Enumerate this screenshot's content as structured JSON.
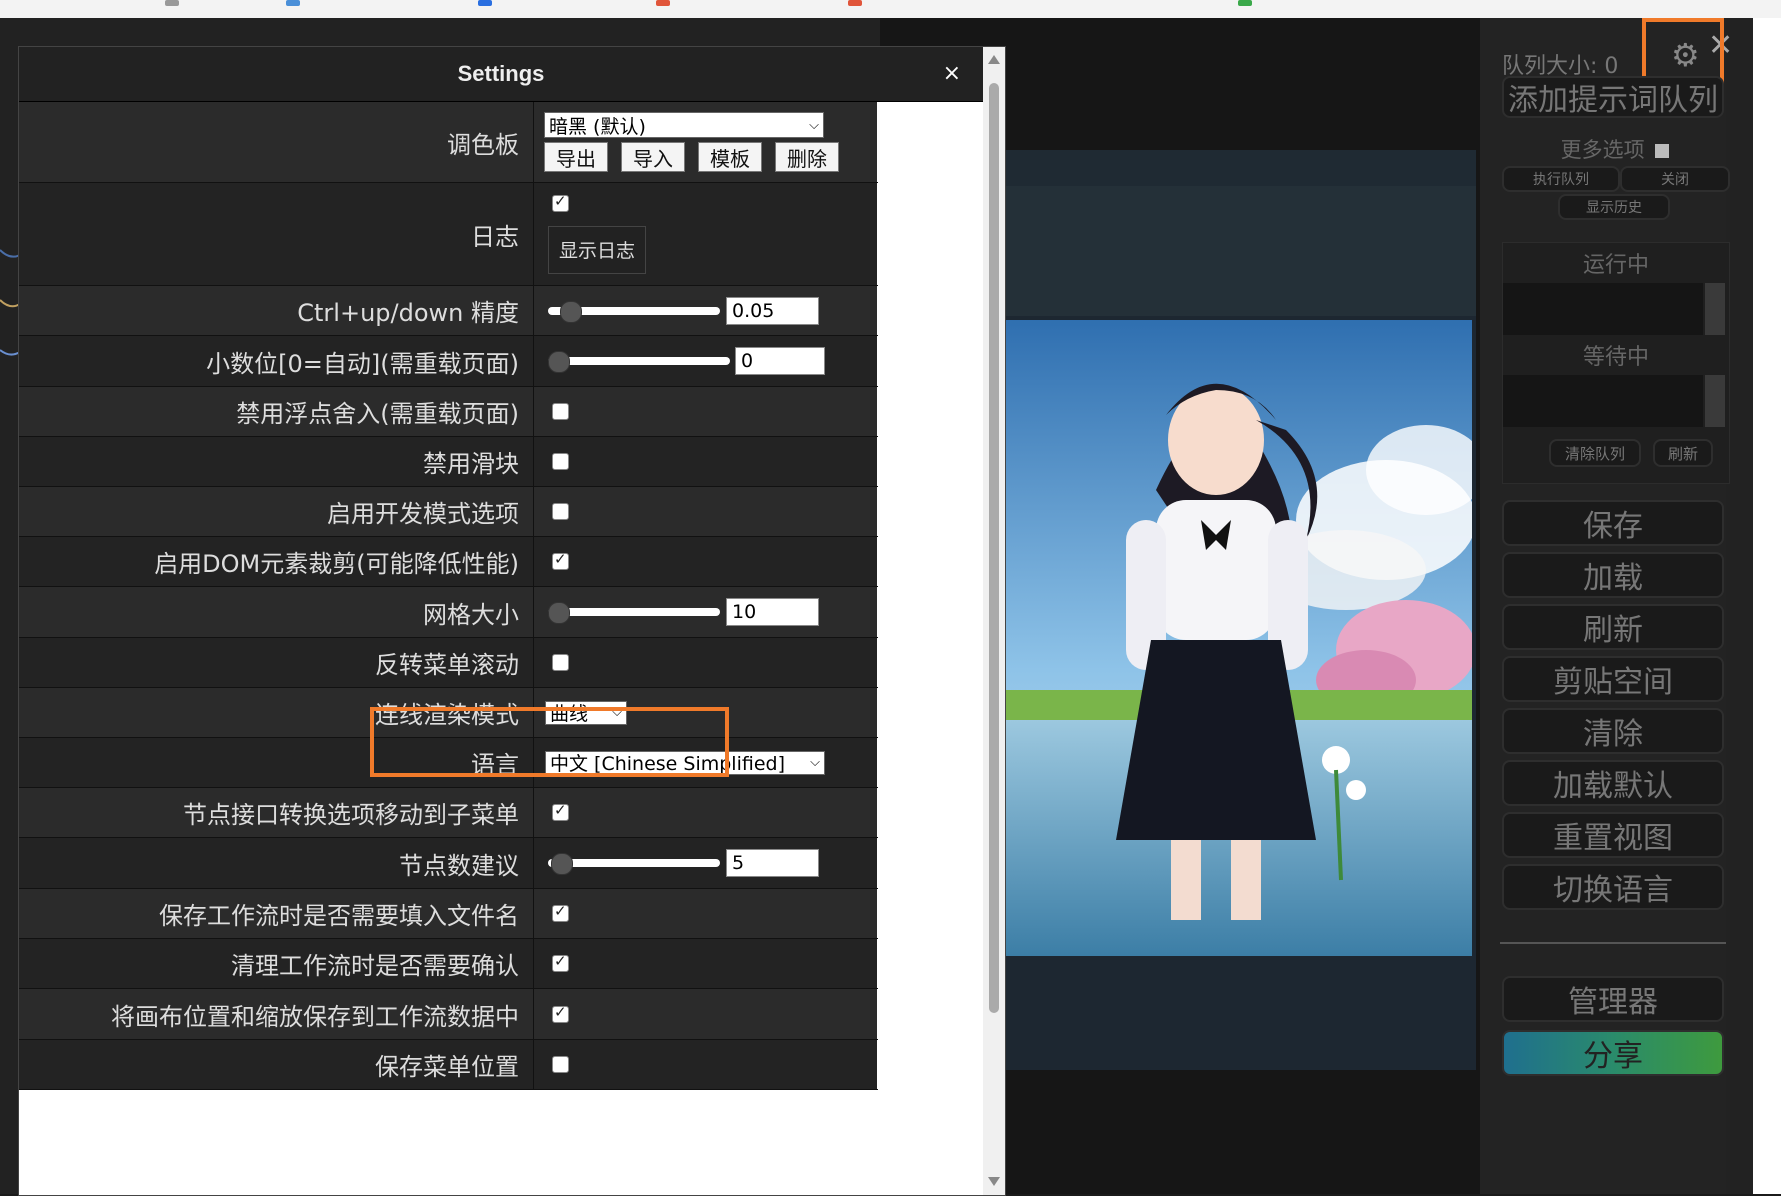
{
  "dialog": {
    "title": "Settings",
    "close": "×"
  },
  "settings": [
    {
      "label": "调色板",
      "palette": {
        "selected": "暗黑 (默认)",
        "buttons": [
          "导出",
          "导入",
          "模板",
          "删除"
        ]
      }
    },
    {
      "label": "日志",
      "checked": true,
      "button": "显示日志"
    },
    {
      "label": "Ctrl+up/down 精度",
      "slider_value": "0.05"
    },
    {
      "label": "小数位[0=自动](需重载页面)",
      "slider_value": "0"
    },
    {
      "label": "禁用浮点舍入(需重载页面)",
      "checked": false
    },
    {
      "label": "禁用滑块",
      "checked": false
    },
    {
      "label": "启用开发模式选项",
      "checked": false
    },
    {
      "label": "启用DOM元素裁剪(可能降低性能)",
      "checked": true
    },
    {
      "label": "网格大小",
      "slider_value": "10"
    },
    {
      "label": "反转菜单滚动",
      "checked": false
    },
    {
      "label": "连线渲染模式",
      "selected": "曲线"
    },
    {
      "label": "语言",
      "selected": "中文 [Chinese Simplified]"
    },
    {
      "label": "节点接口转换选项移动到子菜单",
      "checked": true
    },
    {
      "label": "节点数建议",
      "slider_value": "5"
    },
    {
      "label": "保存工作流时是否需要填入文件名",
      "checked": true
    },
    {
      "label": "清理工作流时是否需要确认",
      "checked": true
    },
    {
      "label": "将画布位置和缩放保存到工作流数据中",
      "checked": true
    },
    {
      "label": "保存菜单位置",
      "checked": false
    }
  ],
  "menu": {
    "queue_size": "队列大小: 0",
    "add_queue": "添加提示词队列",
    "more_options": "更多选项",
    "run_queue": "执行队列",
    "close": "关闭",
    "show_history": "显示历史",
    "running": "运行中",
    "pending": "等待中",
    "clear_queue": "清除队列",
    "refresh_small": "刷新",
    "buttons": [
      "保存",
      "加载",
      "刷新",
      "剪贴空间",
      "清除",
      "加载默认",
      "重置视图",
      "切换语言"
    ],
    "manager": "管理器",
    "share": "分享"
  },
  "colors": {
    "highlight": "#f07a2a",
    "dialog_bg": "#2b2b2b"
  }
}
